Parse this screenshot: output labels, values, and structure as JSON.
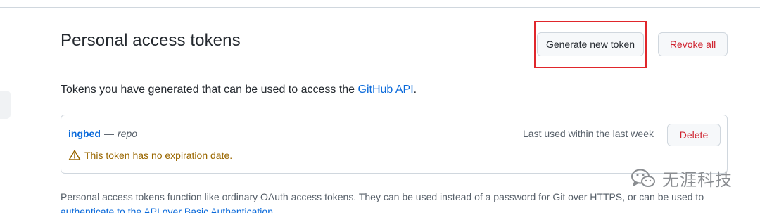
{
  "page": {
    "title": "Personal access tokens",
    "intro_text": "Tokens you have generated that can be used to access the ",
    "intro_link": "GitHub API",
    "intro_end": "."
  },
  "actions": {
    "generate_label": "Generate new token",
    "revoke_label": "Revoke all"
  },
  "token": {
    "name": "ingbed",
    "separator": "—",
    "scope": "repo",
    "last_used": "Last used within the last week",
    "delete_label": "Delete",
    "warning": "This token has no expiration date."
  },
  "footer": {
    "text": "Personal access tokens function like ordinary OAuth access tokens. They can be used instead of a password for Git over HTTPS, or can be used to",
    "link": "authenticate to the API over Basic Authentication."
  },
  "watermark": {
    "text": "无涯科技"
  },
  "colors": {
    "link": "#0969da",
    "danger": "#cf222e",
    "warning": "#9a6700",
    "highlight": "#e0262b"
  },
  "icons": {
    "warning": "alert-triangle-icon",
    "watermark": "wechat-icon"
  }
}
